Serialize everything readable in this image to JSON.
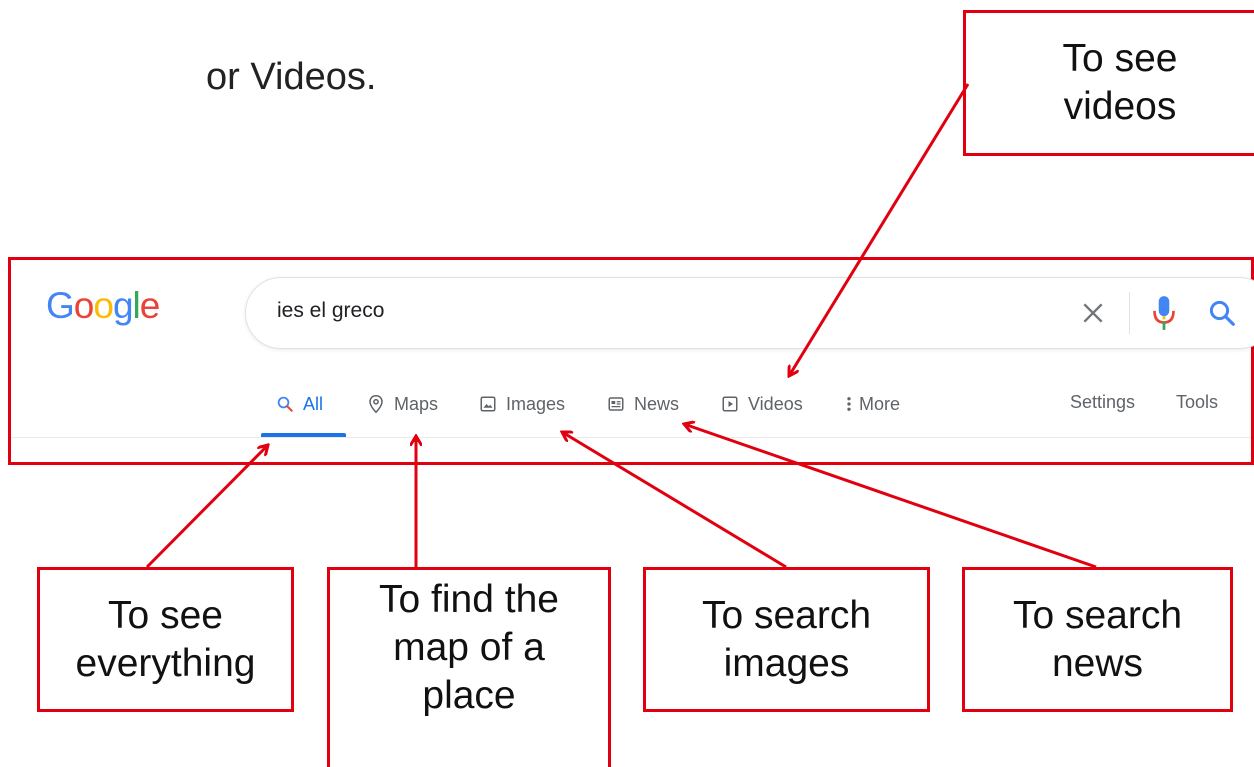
{
  "slide": {
    "text": "or Videos."
  },
  "google": {
    "logo_letters": [
      {
        "ch": "G",
        "color": "#4285F4"
      },
      {
        "ch": "o",
        "color": "#EA4335"
      },
      {
        "ch": "o",
        "color": "#FBBC05"
      },
      {
        "ch": "g",
        "color": "#4285F4"
      },
      {
        "ch": "l",
        "color": "#34A853"
      },
      {
        "ch": "e",
        "color": "#EA4335"
      }
    ],
    "search": {
      "query": "ies el greco"
    },
    "tabs": {
      "all": "All",
      "maps": "Maps",
      "images": "Images",
      "news": "News",
      "videos": "Videos",
      "more": "More"
    },
    "settings": "Settings",
    "tools": "Tools"
  },
  "callouts": {
    "videos": "To see\nvideos",
    "everything": "To see\neverything",
    "maps": "To find the\nmap of a\nplace",
    "images": "To search\nimages",
    "news": "To search\nnews"
  },
  "colors": {
    "annotation": "#e0000f",
    "active_tab": "#1a73e8",
    "tab_text": "#5f6368"
  }
}
